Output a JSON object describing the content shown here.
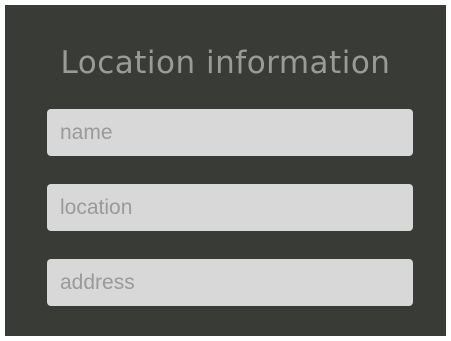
{
  "form": {
    "title": "Location information",
    "fields": [
      {
        "placeholder": "name",
        "value": ""
      },
      {
        "placeholder": "location",
        "value": ""
      },
      {
        "placeholder": "address",
        "value": ""
      }
    ]
  },
  "colors": {
    "panel_background": "#393b37",
    "title_text": "#9a9b98",
    "field_background": "#d8d8d8",
    "placeholder_text": "#9a9a9a",
    "outer_border": "#ffffff"
  }
}
